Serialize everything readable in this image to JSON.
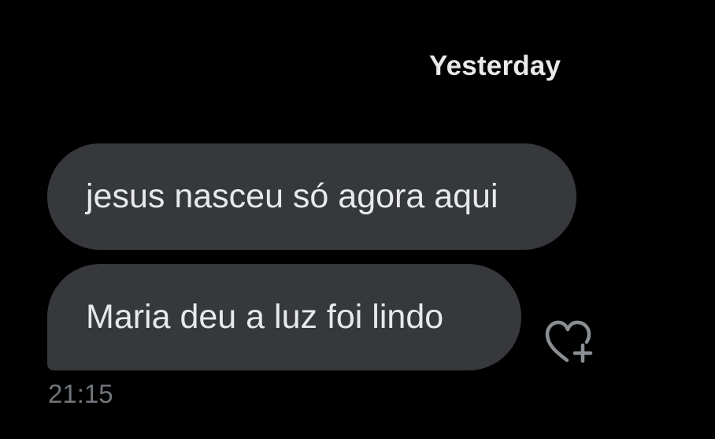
{
  "conversation": {
    "date_divider": "Yesterday",
    "messages": [
      {
        "text": "jesus nasceu só agora aqui"
      },
      {
        "text": "Maria deu a luz foi lindo"
      }
    ],
    "timestamp": "21:15"
  },
  "icons": {
    "reaction": "heart-plus-icon"
  },
  "colors": {
    "background": "#000000",
    "bubble": "#37383c",
    "text": "#e7e9ea",
    "muted": "#71767b"
  }
}
